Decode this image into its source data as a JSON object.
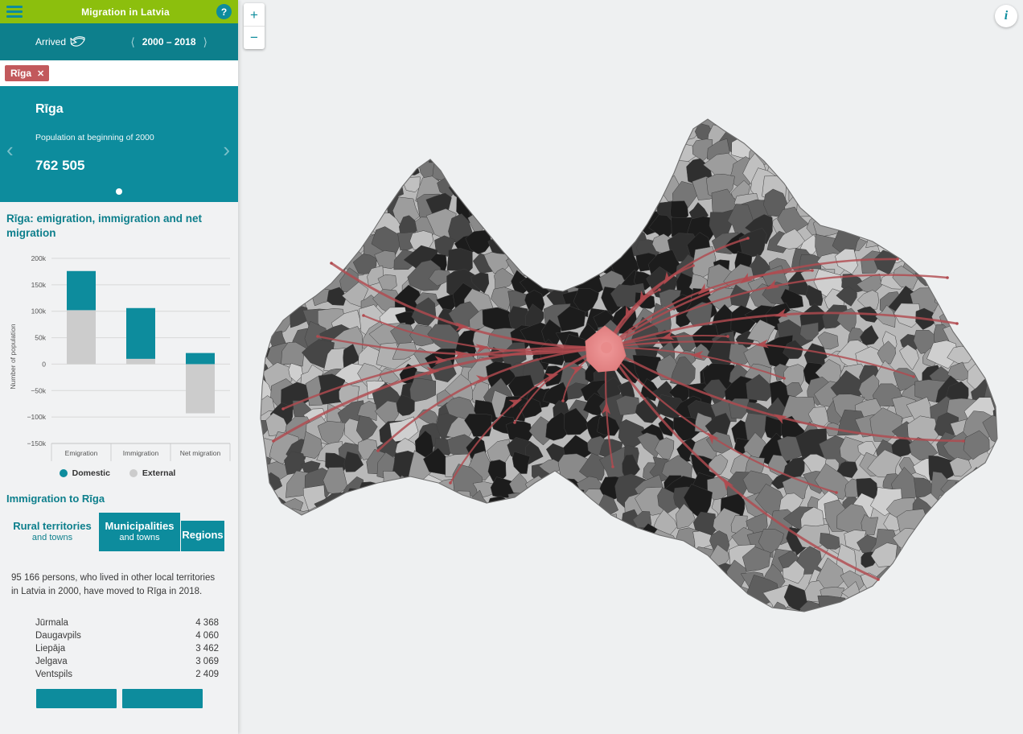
{
  "header": {
    "menu_icon": "hamburger-icon",
    "title": "Migration in Latvia",
    "help_label": "?",
    "green": "#8cbf0d",
    "teal": "#0d8c9d"
  },
  "controls": {
    "direction_label": "Arrived",
    "direction_icon": "curved-arrow-inbound-icon",
    "period_label": "2000 – 2018",
    "prev_icon": "chevron-left-icon",
    "next_icon": "chevron-right-icon"
  },
  "selection": {
    "tag_label": "Rīga",
    "tag_remove_icon": "close-icon",
    "tag_color": "#c2595c"
  },
  "info_card": {
    "title": "Rīga",
    "subtitle": "Population at beginning of 2000",
    "value": "762 505",
    "prev_icon": "chevron-left-icon",
    "next_icon": "chevron-right-icon",
    "dots": 1
  },
  "chart_data": {
    "type": "bar",
    "title": "Rīga: emigration, immigration and net migration",
    "xlabel": "",
    "ylabel": "Number of population",
    "categories": [
      "Emigration",
      "Immigration",
      "Net migration"
    ],
    "series": [
      {
        "name": "Domestic",
        "color": "#0d8c9d",
        "values": [
          74000,
          96000,
          21000
        ]
      },
      {
        "name": "External",
        "color": "#cccccc",
        "values": [
          102000,
          10000,
          -93000
        ]
      }
    ],
    "stacked": true,
    "ylim": [
      -150000,
      200000
    ],
    "yticks": [
      -150000,
      -100000,
      -50000,
      0,
      50000,
      100000,
      150000,
      200000
    ],
    "ytick_labels": [
      "−150k",
      "−100k",
      "−50k",
      "0",
      "50k",
      "100k",
      "150k",
      "200k"
    ],
    "grid": true,
    "legend_position": "bottom",
    "legend": [
      "Domestic",
      "External"
    ]
  },
  "immigration": {
    "title": "Immigration to Rīga",
    "tabs": [
      {
        "id": "rural",
        "main": "Rural territories",
        "sub": "and towns",
        "active": false
      },
      {
        "id": "municipalities",
        "main": "Municipalities",
        "sub": "and towns",
        "active": true
      },
      {
        "id": "regions",
        "main": "Regions",
        "sub": "",
        "active": true
      }
    ],
    "summary": "95 166 persons, who lived in other local territories in Latvia in 2000, have moved to Rīga in 2018.",
    "destinations": [
      {
        "name": "Jūrmala",
        "value": "4 368"
      },
      {
        "name": "Daugavpils",
        "value": "4 060"
      },
      {
        "name": "Liepāja",
        "value": "3 462"
      },
      {
        "name": "Jelgava",
        "value": "3 069"
      },
      {
        "name": "Ventspils",
        "value": "2 409"
      }
    ],
    "actions": [
      {
        "id": "action-left",
        "label": ""
      },
      {
        "id": "action-right",
        "label": ""
      }
    ]
  },
  "map": {
    "zoom_in_label": "+",
    "zoom_out_label": "−",
    "info_label": "i",
    "hub_label": "Rīga",
    "flow_color": "#b14a4f",
    "hub_color": "#ef8a8a",
    "background": "#eef0f1"
  }
}
